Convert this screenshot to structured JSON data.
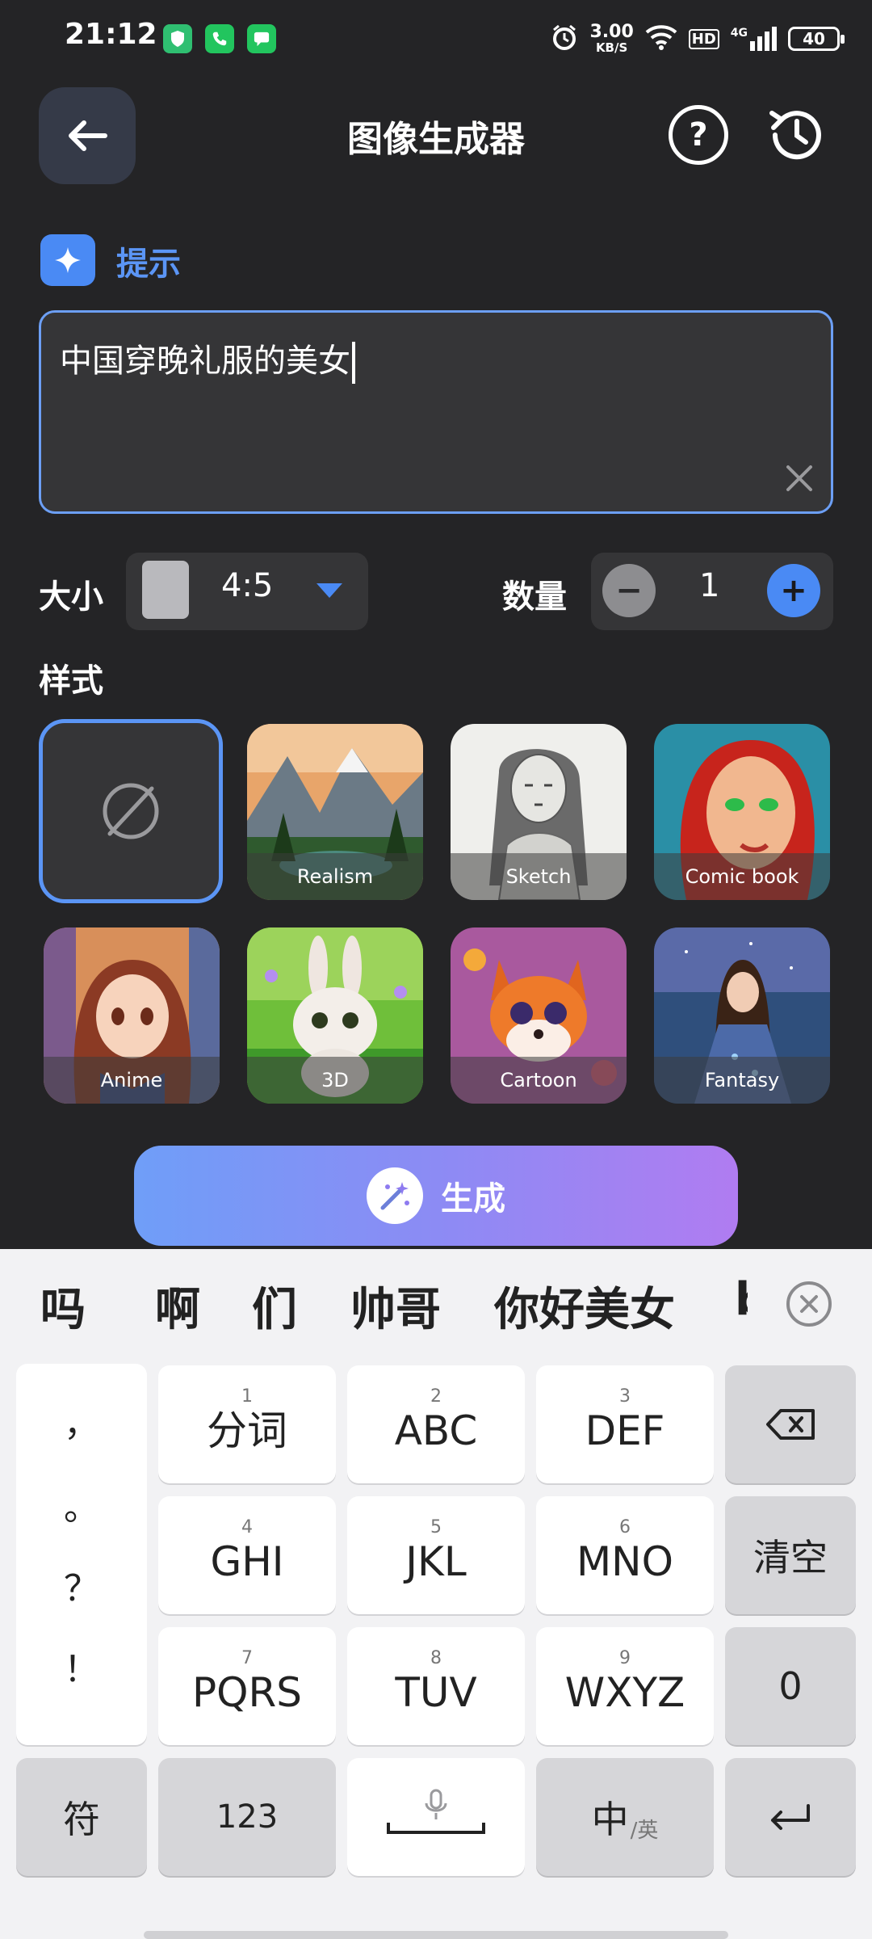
{
  "status_bar": {
    "time": "21:12",
    "speed_value": "3.00",
    "speed_unit": "KB/S",
    "hd": "HD",
    "network": "4G",
    "battery": "40"
  },
  "header": {
    "title": "图像生成器",
    "help": "?"
  },
  "prompt": {
    "label": "提示",
    "value": "中国穿晚礼服的美女"
  },
  "size": {
    "label": "大小",
    "value": "4:5"
  },
  "count": {
    "label": "数量",
    "value": "1",
    "minus": "−",
    "plus": "+"
  },
  "styles": {
    "label": "样式",
    "items": [
      {
        "label": ""
      },
      {
        "label": "Realism"
      },
      {
        "label": "Sketch"
      },
      {
        "label": "Comic book"
      },
      {
        "label": "Anime"
      },
      {
        "label": "3D"
      },
      {
        "label": "Cartoon"
      },
      {
        "label": "Fantasy"
      }
    ]
  },
  "generate": {
    "label": "生成"
  },
  "keyboard": {
    "suggestions": [
      "吗",
      "啊",
      "们",
      "帅哥",
      "你好美女",
      "b"
    ],
    "punctuation": [
      "，",
      "。",
      "？",
      "！"
    ],
    "keys": [
      {
        "num": "1",
        "label": "分词"
      },
      {
        "num": "2",
        "label": "ABC"
      },
      {
        "num": "3",
        "label": "DEF"
      },
      {
        "num": "4",
        "label": "GHI"
      },
      {
        "num": "5",
        "label": "JKL"
      },
      {
        "num": "6",
        "label": "MNO"
      },
      {
        "num": "7",
        "label": "PQRS"
      },
      {
        "num": "8",
        "label": "TUV"
      },
      {
        "num": "9",
        "label": "WXYZ"
      }
    ],
    "clear": "清空",
    "zero": "0",
    "symbols": "符",
    "numbers": "123",
    "lang_main": "中",
    "lang_sub": "/英"
  }
}
